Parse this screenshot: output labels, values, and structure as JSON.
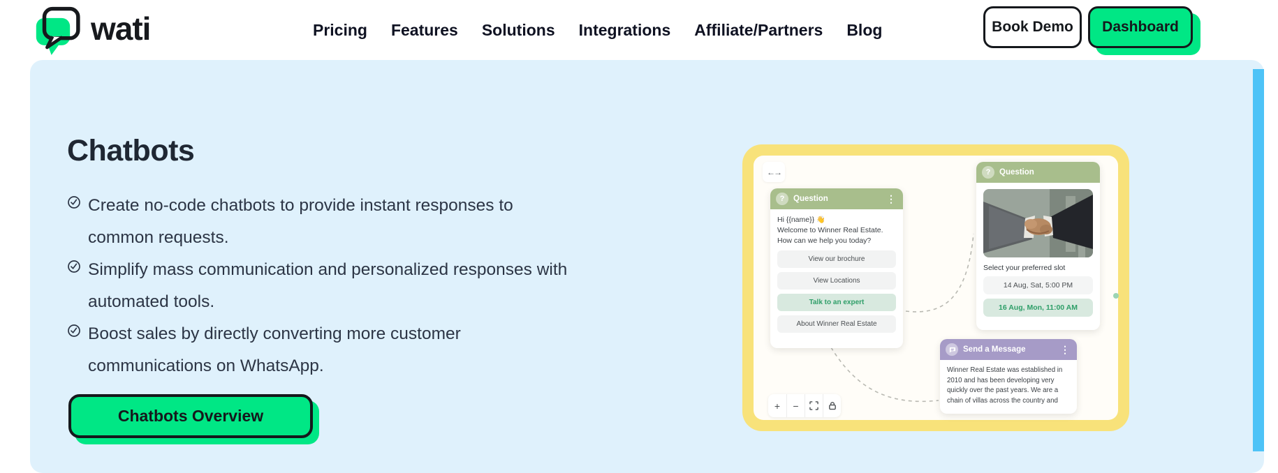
{
  "header": {
    "logo_text": "wati",
    "nav": [
      "Pricing",
      "Features",
      "Solutions",
      "Integrations",
      "Affiliate/Partners",
      "Blog"
    ],
    "book_demo_label": "Book Demo",
    "dashboard_label": "Dashboard"
  },
  "hero": {
    "title": "Chatbots",
    "bullets": [
      "Create no-code chatbots to provide instant responses to\ncommon requests.",
      "Simplify mass communication and personalized responses with\nautomated tools.",
      "Boost sales by directly converting more customer\ncommunications on WhatsApp."
    ],
    "cta_label": "Chatbots Overview"
  },
  "builder": {
    "resize_icon": "←→",
    "question_card_1": {
      "header_label": "Question",
      "icon": "?",
      "menu_icon": "⋮",
      "message_greeting": "Hi {{name}}",
      "wave_emoji": "👋",
      "message_line2": "Welcome to Winner Real Estate.",
      "message_line3": "How can we help you today?",
      "options": [
        "View our brochure",
        "View Locations",
        "Talk to an expert",
        "About Winner Real Estate"
      ]
    },
    "question_card_2": {
      "header_label": "Question",
      "icon": "?",
      "caption": "Select your preferred slot",
      "slots": [
        "14 Aug, Sat, 5:00 PM",
        "16 Aug, Mon, 11:00 AM"
      ]
    },
    "message_card": {
      "header_label": "Send a Message",
      "menu_icon": "⋮",
      "body": "Winner Real Estate was established in\n2010 and has been developing very\nquickly over the past years. We are a\nchain of villas across the country and"
    },
    "toolbar": {
      "zoom_in": "+",
      "zoom_out": "−"
    }
  },
  "colors": {
    "brand_green": "#00E785",
    "section_blue": "#DFF1FC",
    "accent_blue": "#4EC3F7",
    "panel_yellow": "#F8E27A",
    "card_header_green": "#A8BE8C",
    "card_header_purple": "#A69BC7",
    "slot_green_bg": "#D8E9DF",
    "slot_green_text": "#2E9E68",
    "ink": "#15181c"
  }
}
